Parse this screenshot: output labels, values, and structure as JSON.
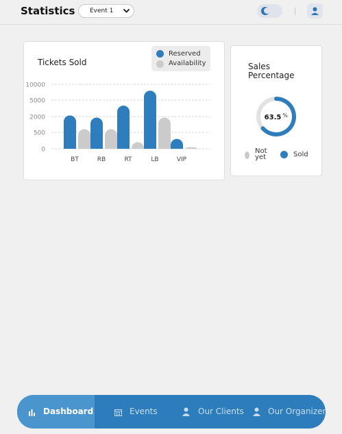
{
  "header": {
    "title": "Statistics",
    "event_select": {
      "value": "Event 1"
    },
    "theme_icon": "moon-icon",
    "user_icon": "user-icon"
  },
  "tickets_card": {
    "title": "Tickets Sold",
    "legend": [
      {
        "label": "Reserved",
        "color": "#2e7ebd"
      },
      {
        "label": "Availability",
        "color": "#cbcbcb"
      }
    ]
  },
  "sales_card": {
    "title_line1": "Sales",
    "title_line2": "Percentage",
    "value": "63.5",
    "unit": "%",
    "percent": 63.5,
    "legend": [
      {
        "label_line1": "Not",
        "label_line2": "yet",
        "color": "#cbcbcb"
      },
      {
        "label": "Sold",
        "color": "#2e7ebd"
      }
    ]
  },
  "chart_data": [
    {
      "type": "bar",
      "title": "Tickets Sold",
      "categories": [
        "BT",
        "RB",
        "RT",
        "LB",
        "VIP"
      ],
      "y_ticks": [
        "10000",
        "5000",
        "2000",
        "500",
        "0"
      ],
      "series": [
        {
          "name": "Reserved",
          "color": "#2e7ebd",
          "values": [
            2200,
            1900,
            4000,
            8000,
            300
          ]
        },
        {
          "name": "Availability",
          "color": "#cbcbcb",
          "values": [
            800,
            800,
            200,
            1900,
            50
          ]
        }
      ],
      "grid": true,
      "legend_position": "top-right"
    },
    {
      "type": "pie",
      "title": "Sales Percentage",
      "series": [
        {
          "name": "Sold",
          "value": 63.5,
          "color": "#2e7ebd"
        },
        {
          "name": "Not yet",
          "value": 36.5,
          "color": "#e2e2e2"
        }
      ]
    }
  ],
  "navbar": {
    "items": [
      {
        "label": "Dashboard",
        "icon": "bar-chart-icon",
        "active": true
      },
      {
        "label": "Events",
        "icon": "calendar-icon",
        "active": false
      },
      {
        "label": "Our Clients",
        "icon": "person-icon",
        "active": false
      },
      {
        "label": "Our Organizers",
        "icon": "person-icon",
        "active": false
      }
    ]
  }
}
